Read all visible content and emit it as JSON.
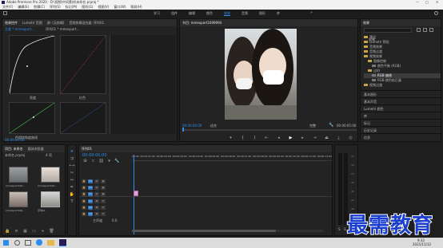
{
  "titlebar": {
    "title": "Adobe Premiere Pro 2020 - D:\\视频\\中间素材\\未命名.prproj *"
  },
  "menubar": [
    "文件(F)",
    "编辑(E)",
    "剪辑(C)",
    "序列(S)",
    "标记(M)",
    "图形(G)",
    "视图(V)",
    "窗口(W)",
    "帮助(H)"
  ],
  "workspaces": {
    "items": [
      "学习",
      "组件",
      "编辑",
      "颜色",
      "效果",
      "音频",
      "图形",
      "库"
    ],
    "active": "效果"
  },
  "lumetri": {
    "tabs": [
      "效果控件",
      "Lumetri 范围",
      "源: (无剪辑)",
      "音频剪辑混合器: 序列01"
    ],
    "clip_label": "主要 * mmexport... ",
    "sequence_label": "序列01 * mmexport...",
    "label_luma": "亮度",
    "label_red": "红色",
    "label_green": "绿色",
    "label_blue": "蓝色",
    "label_hue": "色相饱和度曲线",
    "timecode": "00:00:00:00"
  },
  "program_monitor": {
    "title": "节目: mmexport1606994",
    "timecode_left": "00:00:00:00",
    "fit": "适合",
    "quality": "完整",
    "timecode_right": "00:00:05:00"
  },
  "effects_panel": {
    "title": "效果",
    "search_placeholder": "效果",
    "items": [
      {
        "label": "预设",
        "indent": 0,
        "selected": false
      },
      {
        "label": "Lumetri 预设",
        "indent": 0,
        "selected": false
      },
      {
        "label": "音频效果",
        "indent": 0,
        "selected": false
      },
      {
        "label": "音频过渡",
        "indent": 0,
        "selected": false
      },
      {
        "label": "视频效果",
        "indent": 0,
        "selected": false
      },
      {
        "label": "图像控制",
        "indent": 1,
        "selected": false
      },
      {
        "label": "颜色平衡 (RGB)",
        "indent": 2,
        "selected": false
      },
      {
        "label": "过时",
        "indent": 1,
        "selected": false
      },
      {
        "label": "RGB 曲线",
        "indent": 2,
        "selected": true
      },
      {
        "label": "RGB 颜色校正器",
        "indent": 2,
        "selected": false
      },
      {
        "label": "视频过渡",
        "indent": 0,
        "selected": false
      }
    ],
    "sections": [
      "基本图形",
      "基本声音",
      "Lumetri 颜色",
      "库",
      "标记",
      "历史记录",
      "信息"
    ]
  },
  "project_panel": {
    "tabs": [
      "项目: 未命名",
      "媒体浏览器"
    ],
    "project_name": "未命名.prproj",
    "item_count": "4 项",
    "items": [
      {
        "name": "mmexport160...",
        "duration": "5:00"
      },
      {
        "name": "mmexport160...",
        "duration": "5:00"
      },
      {
        "name": "mmexport160...",
        "duration": "5:00"
      },
      {
        "name": "序列01",
        "duration": "5:00"
      }
    ]
  },
  "timeline": {
    "tab": "序列01",
    "timecode": "00:00:00:00",
    "ruler": [
      "00:00",
      "00:00:01:00",
      "00:00:02:00",
      "00:00:03:00",
      "00:00:04:00",
      "00:00:05:00",
      "00:00:06:00",
      "00:00:07:00",
      "00:00:08:00",
      "00:00:09:00",
      "00:00:10:00",
      "00:00:11:00",
      "00:00:12:00"
    ],
    "tracks": [
      "V3",
      "V2",
      "V1",
      "A1",
      "A2",
      "A3"
    ],
    "master": "主声道",
    "master_value": "0.0"
  },
  "vu": {
    "ticks": [
      "-12",
      "-18",
      "-24",
      "-30",
      "-36",
      "-42",
      "-48",
      "-54"
    ],
    "label_s": "S",
    "label_s2": "S"
  },
  "watermark": "最需教育",
  "taskbar": {
    "time": "9:32",
    "date": "2021/11/12"
  }
}
